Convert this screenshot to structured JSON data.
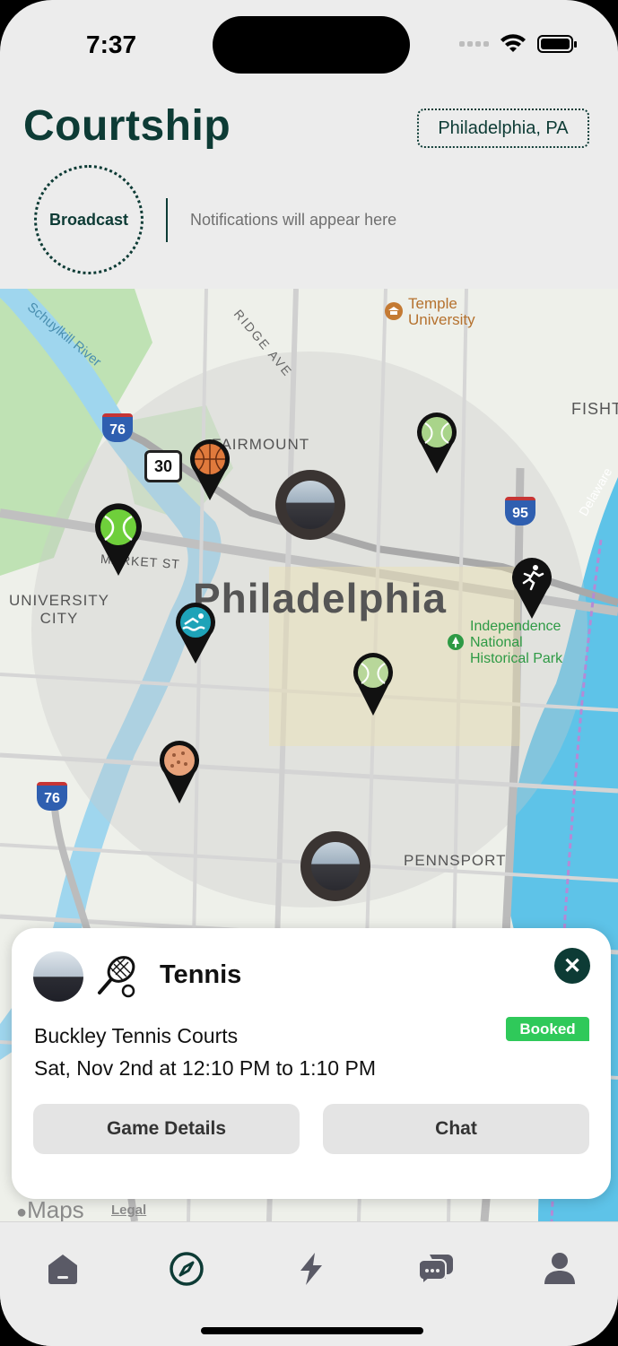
{
  "status_bar": {
    "time": "7:37"
  },
  "header": {
    "app_title": "Courtship",
    "location": "Philadelphia, PA",
    "broadcast_label": "Broadcast",
    "notifications_placeholder": "Notifications will appear here"
  },
  "map": {
    "labels": {
      "city": "Philadelphia",
      "temple": "Temple\nUniversity",
      "fairmount": "FAIRMOUNT",
      "university_city": "UNIVERSITY\nCITY",
      "market_st": "MARKET ST",
      "independence": "Independence\nNational\nHistorical Park",
      "pennsport": "PENNSPORT",
      "ridge_ave": "RIDGE AVE",
      "schuylkill": "Schuylkill River",
      "fishtown": "FISHT",
      "delaware": "Delaware",
      "i76_top": "76",
      "i76_bottom": "76",
      "us30": "30",
      "i95": "95"
    },
    "pins": [
      {
        "name": "tennis-pin",
        "icon": "tennis-ball-icon"
      },
      {
        "name": "basketball-pin",
        "icon": "basketball-icon"
      },
      {
        "name": "tennis-pin",
        "icon": "tennis-ball-icon"
      },
      {
        "name": "tennis-pin",
        "icon": "tennis-ball-icon"
      },
      {
        "name": "swimming-pin",
        "icon": "swimmer-icon"
      },
      {
        "name": "running-pin",
        "icon": "runner-icon"
      },
      {
        "name": "pickleball-pin",
        "icon": "pickleball-icon"
      }
    ],
    "credit": "Maps",
    "legal": "Legal"
  },
  "game_card": {
    "sport": "Tennis",
    "venue": "Buckley Tennis Courts",
    "time": "Sat, Nov 2nd at 12:10 PM to 1:10 PM",
    "status": "Booked",
    "details_label": "Game Details",
    "chat_label": "Chat"
  },
  "tab_bar": {
    "items": [
      {
        "icon": "home-icon",
        "selected": false
      },
      {
        "icon": "compass-icon",
        "selected": true
      },
      {
        "icon": "lightning-icon",
        "selected": false
      },
      {
        "icon": "chat-bubbles-icon",
        "selected": false
      },
      {
        "icon": "profile-icon",
        "selected": false
      }
    ]
  },
  "colors": {
    "brand": "#0d3b35",
    "booked": "#2fc95a",
    "card_bg": "#ffffff"
  }
}
